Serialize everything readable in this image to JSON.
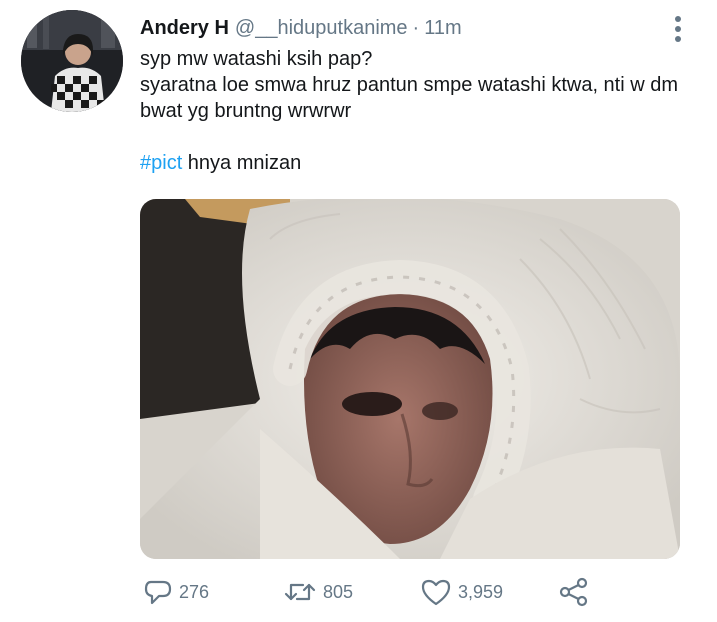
{
  "tweet": {
    "author_name": "Andery H",
    "author_handle": "@__hiduputkanime",
    "separator": "·",
    "timestamp": "11m",
    "lines": [
      "syp mw watashi ksih pap?",
      "syaratna loe smwa hruz pantun smpe watashi ktwa, nti w dm bwat yg bruntng wrwrwr"
    ],
    "hashtag": "#pict",
    "hashtag_rest": " hnya mnizan",
    "hashtag_color": "#1da1f2"
  },
  "actions": {
    "reply_count": "276",
    "retweet_count": "805",
    "like_count": "3,959",
    "icons": [
      "reply-icon",
      "retweet-icon",
      "like-icon",
      "share-icon"
    ]
  },
  "colors": {
    "text": "#14171a",
    "secondary": "#657786",
    "background": "#ffffff"
  }
}
